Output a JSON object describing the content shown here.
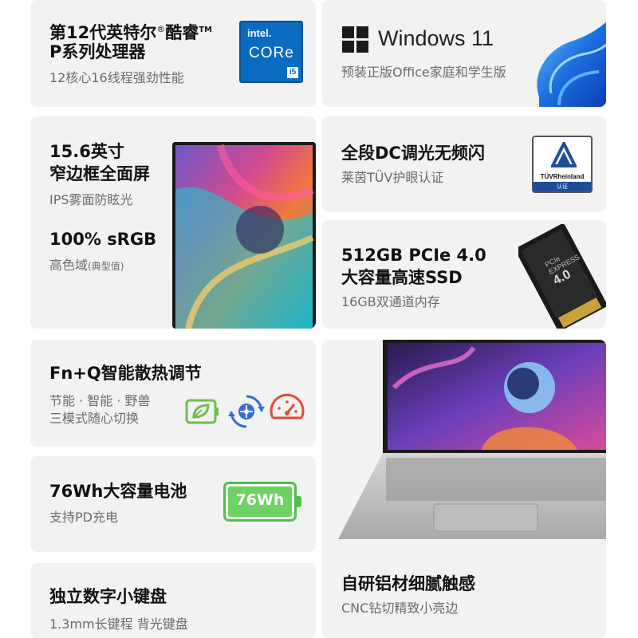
{
  "cpu": {
    "title_line1": "第12代英特尔",
    "title_reg": "®",
    "title_line1_b": "酷睿",
    "title_tm": "TM",
    "title_line2": "P系列处理器",
    "subtitle": "12核心16线程强劲性能",
    "badge_brand": "intel.",
    "badge_core": "CORe",
    "badge_gen": "i5"
  },
  "os": {
    "title": "Windows 11",
    "subtitle": "预装正版Office家庭和学生版"
  },
  "display": {
    "title_line1": "15.6英寸",
    "title_line2": "窄边框全面屏",
    "subtitle": "IPS雾面防眩光",
    "gamut_title": "100% sRGB",
    "gamut_sub": "高色域",
    "gamut_note": "(典型值)"
  },
  "eyecare": {
    "title": "全段DC调光无频闪",
    "subtitle": "莱茵TÜV护眼认证",
    "badge_label": "TÜVRheinland",
    "badge_foot": "认证"
  },
  "ssd": {
    "title_line1": "512GB PCIe 4.0",
    "title_line2": "大容量高速SSD",
    "subtitle": "16GB双通道内存",
    "chip_label1": "PCIe",
    "chip_label2": "EXPRESS",
    "chip_label3": "4.0"
  },
  "thermal": {
    "title": "Fn+Q智能散热调节",
    "subtitle_line1": "节能 · 智能 · 野兽",
    "subtitle_line2": "三模式随心切换"
  },
  "battery": {
    "title": "76Wh大容量电池",
    "subtitle": "支持PD充电",
    "badge": "76Wh"
  },
  "keyboard": {
    "title": "独立数字小键盘",
    "subtitle": "1.3mm长键程 背光键盘"
  },
  "chassis": {
    "title": "自研铝材细腻触感",
    "subtitle": "CNC钻切精致小亮边"
  },
  "colors": {
    "card_bg": "#f2f2f2",
    "title": "#111111",
    "subtitle": "#6b6b6b",
    "battery_green": "#4dc14a",
    "eco_green": "#6cc04a",
    "smart_blue": "#2f6fd6",
    "beast_red": "#e04a35",
    "intel_blue": "#0a6bc1"
  }
}
